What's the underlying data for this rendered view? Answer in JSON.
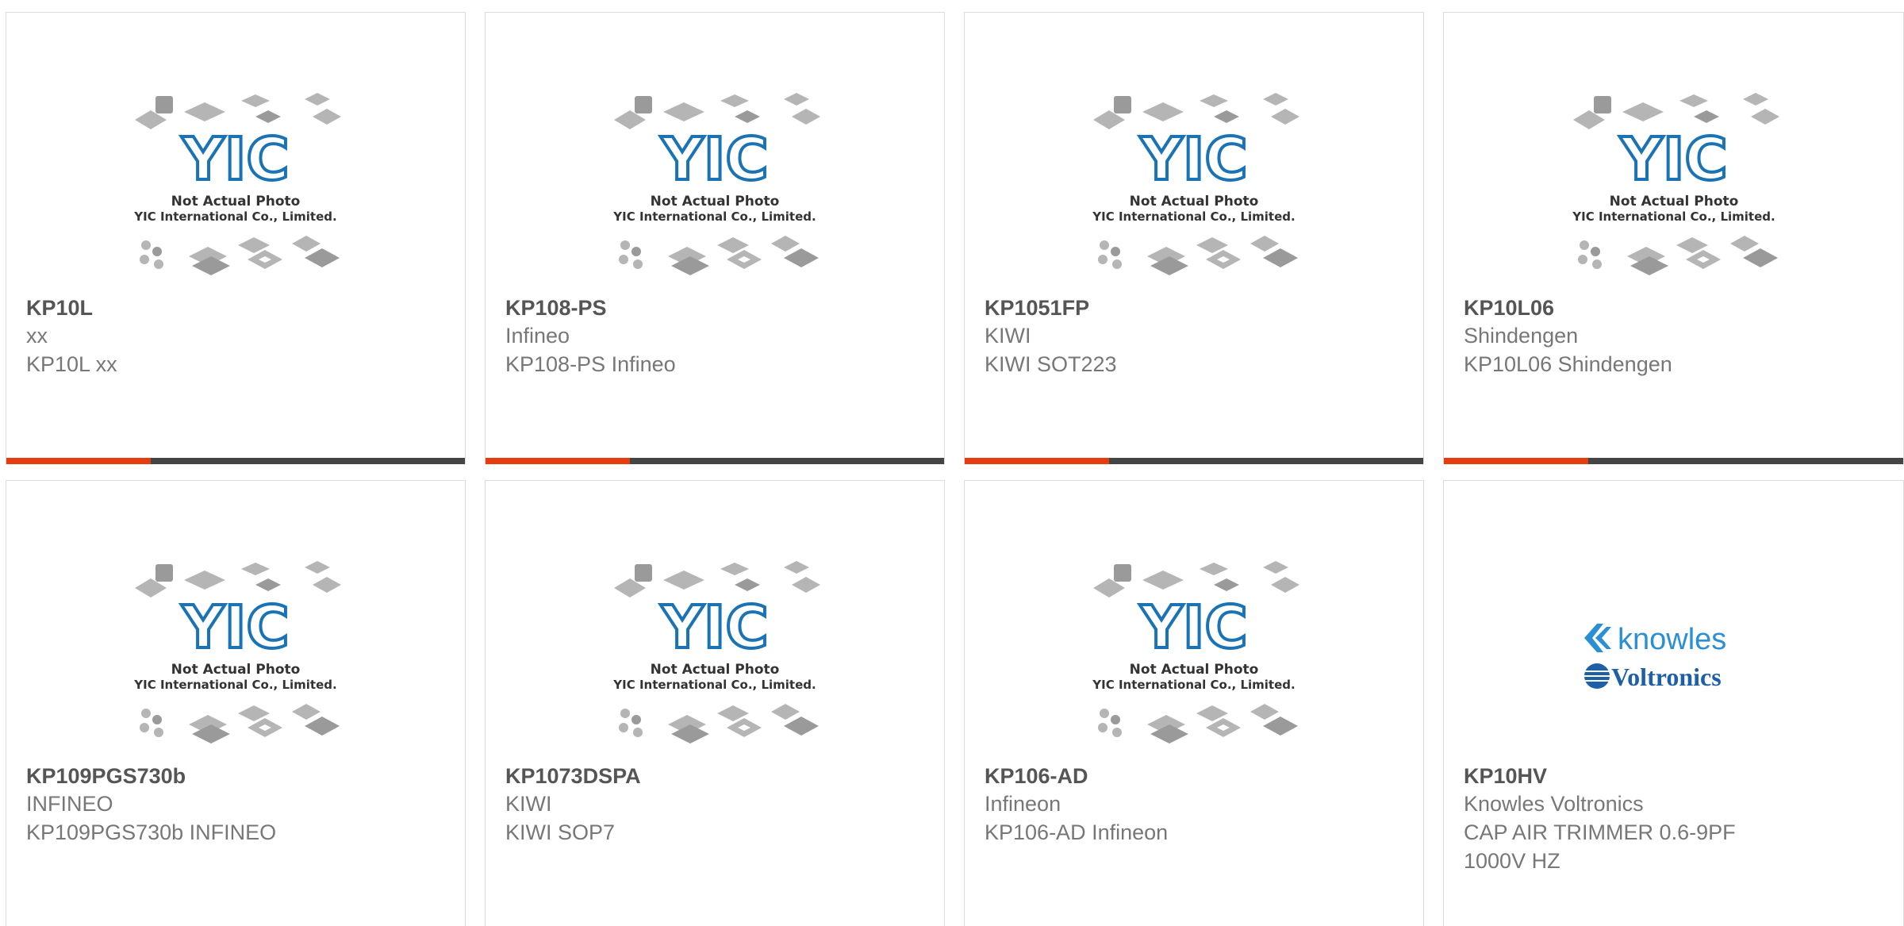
{
  "placeholder": {
    "line1": "Not Actual Photo",
    "line2": "YIC International Co., Limited.",
    "logo_text": "YIC",
    "colors": {
      "logo": "#1a73b5",
      "chip": "#b5b5b5",
      "chip_dark": "#9a9a9a"
    }
  },
  "knowles_logo": {
    "top": "knowles",
    "bottom": "Voltronics",
    "color": "#2a8fd4",
    "dark": "#1e5fa8"
  },
  "accent": "#e53d10",
  "products": [
    {
      "pn": "KP10L",
      "mfr": "xx",
      "desc": "KP10L xx"
    },
    {
      "pn": "KP108-PS",
      "mfr": "Infineo",
      "desc": "KP108-PS Infineo"
    },
    {
      "pn": "KP1051FP",
      "mfr": "KIWI",
      "desc": "KIWI SOT223"
    },
    {
      "pn": "KP10L06",
      "mfr": "Shindengen",
      "desc": "KP10L06 Shindengen"
    },
    {
      "pn": "KP109PGS730b",
      "mfr": "INFINEO",
      "desc": "KP109PGS730b INFINEO"
    },
    {
      "pn": "KP1073DSPA",
      "mfr": "KIWI",
      "desc": "KIWI SOP7"
    },
    {
      "pn": "KP106-AD",
      "mfr": "Infineon",
      "desc": "KP106-AD Infineon"
    },
    {
      "pn": "KP10HV",
      "mfr": "Knowles Voltronics",
      "desc1": "CAP AIR TRIMMER 0.6-9PF",
      "desc2": "1000V HZ"
    }
  ]
}
